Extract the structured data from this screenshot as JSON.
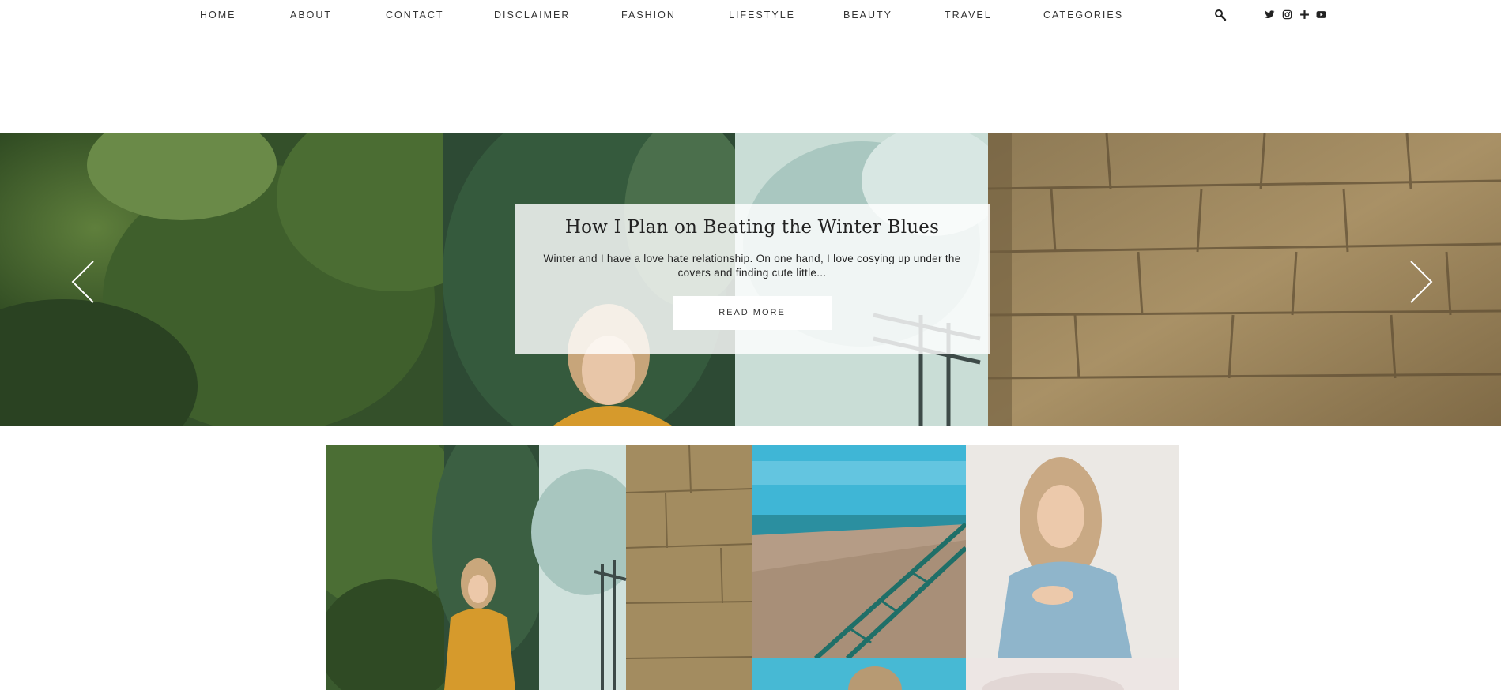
{
  "nav": {
    "items": [
      {
        "label": "HOME",
        "name": "nav-item-home"
      },
      {
        "label": "ABOUT",
        "name": "nav-item-about"
      },
      {
        "label": "CONTACT",
        "name": "nav-item-contact"
      },
      {
        "label": "DISCLAIMER",
        "name": "nav-item-disclaimer"
      },
      {
        "label": "FASHION",
        "name": "nav-item-fashion"
      },
      {
        "label": "LIFESTYLE",
        "name": "nav-item-lifestyle"
      },
      {
        "label": "BEAUTY",
        "name": "nav-item-beauty"
      },
      {
        "label": "TRAVEL",
        "name": "nav-item-travel"
      },
      {
        "label": "CATEGORIES",
        "name": "nav-item-categories"
      }
    ],
    "search_icon": "search-icon",
    "social_icons": [
      "twitter-icon",
      "instagram-icon",
      "bloglovin-icon",
      "youtube-icon"
    ]
  },
  "hero": {
    "title": "How I Plan on Beating the Winter Blues",
    "excerpt": "Winter and I have a love hate relationship. On one hand, I love cosying up under the covers and finding cute little...",
    "button_label": "READ MORE",
    "prev_icon": "chevron-left-icon",
    "next_icon": "chevron-right-icon"
  },
  "colors": {
    "foliage": "#3c5a2c",
    "stone": "#a08a5e",
    "sea": "#2b8fa0",
    "sweater": "#d69a2c",
    "denim": "#8fb5cb"
  }
}
